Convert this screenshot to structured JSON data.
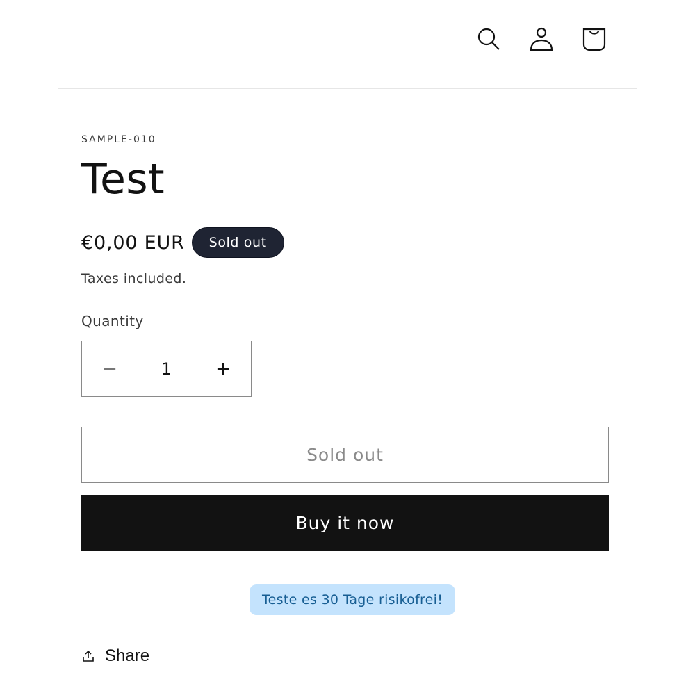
{
  "header": {
    "icons": {
      "search": "search-icon",
      "account": "account-icon",
      "cart": "cart-icon"
    }
  },
  "product": {
    "sku": "SAMPLE-010",
    "title": "Test",
    "price": "€0,00 EUR",
    "badge": "Sold out",
    "taxes_note": "Taxes included.",
    "quantity": {
      "label": "Quantity",
      "value": "1",
      "decrease_symbol": "−",
      "increase_symbol": "+"
    },
    "sold_out_button": "Sold out",
    "buy_now_button": "Buy it now",
    "promo": "Teste es 30 Tage risikofrei!",
    "share_label": "Share"
  },
  "colors": {
    "badge_bg": "#1f2433",
    "buy_bg": "#121212",
    "promo_bg": "#c4e3fd",
    "promo_text": "#175e93"
  }
}
